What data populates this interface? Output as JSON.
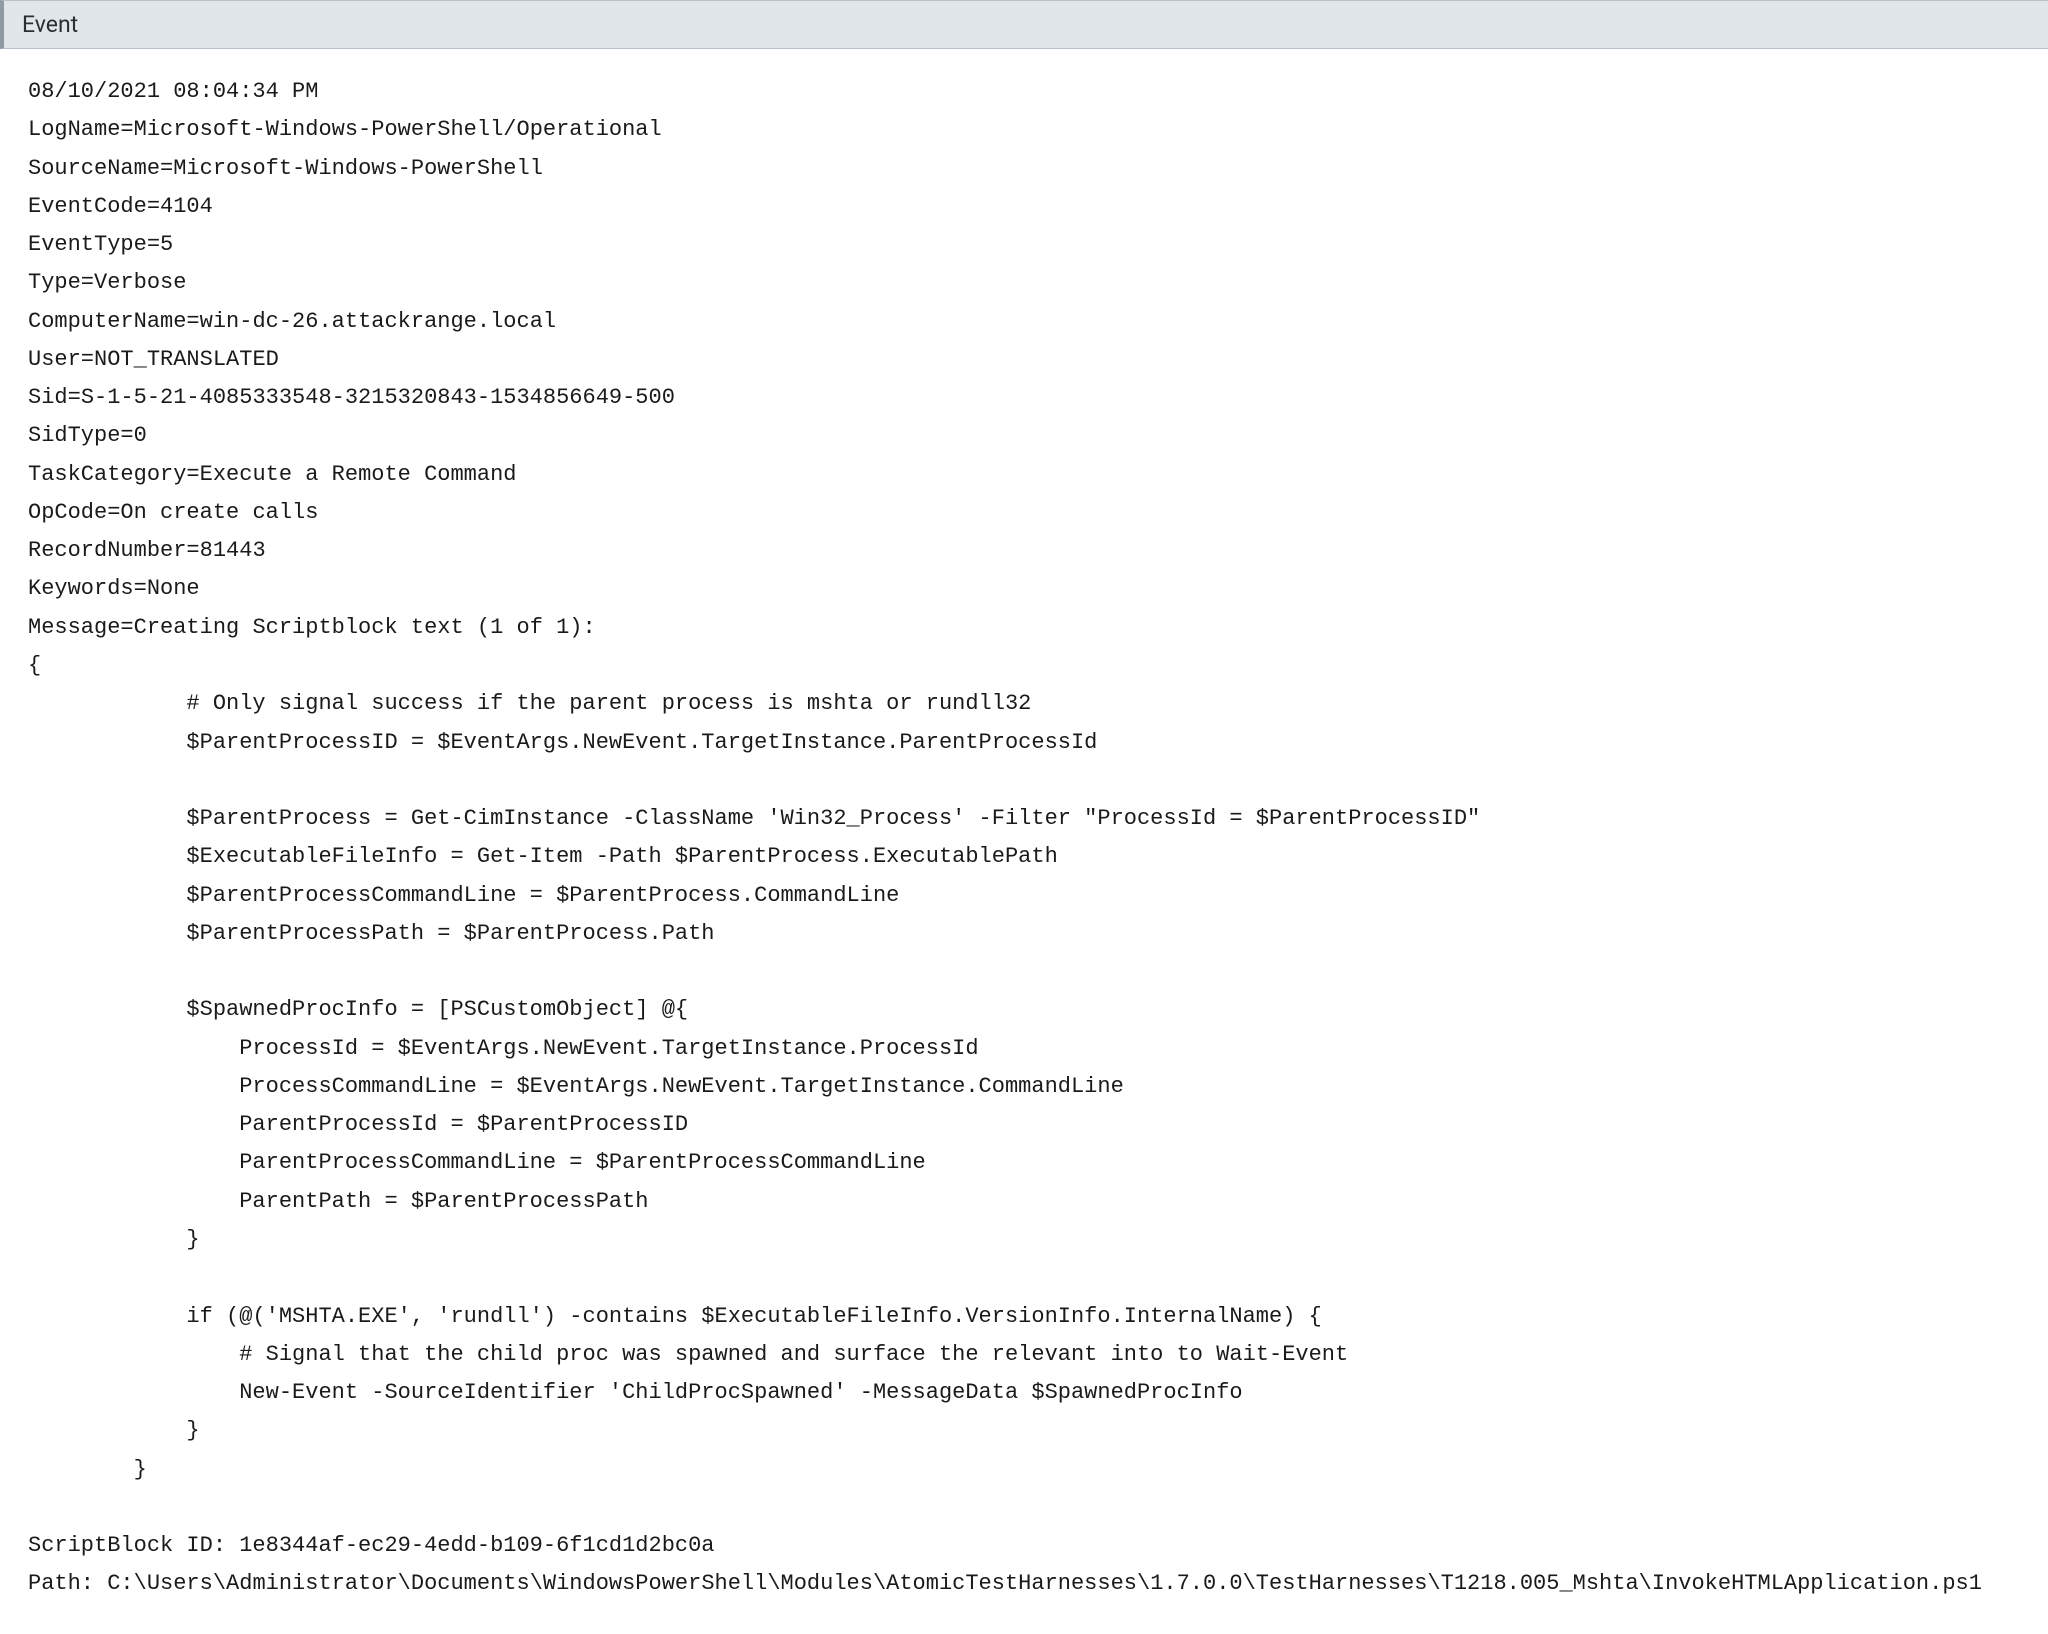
{
  "header": {
    "title": "Event"
  },
  "event": {
    "timestamp": "08/10/2021 08:04:34 PM",
    "LogName": "Microsoft-Windows-PowerShell/Operational",
    "SourceName": "Microsoft-Windows-PowerShell",
    "EventCode": "4104",
    "EventType": "5",
    "Type": "Verbose",
    "ComputerName": "win-dc-26.attackrange.local",
    "User": "NOT_TRANSLATED",
    "Sid": "S-1-5-21-4085333548-3215320843-1534856649-500",
    "SidType": "0",
    "TaskCategory": "Execute a Remote Command",
    "OpCode": "On create calls",
    "RecordNumber": "81443",
    "Keywords": "None",
    "MessageHeader": "Creating Scriptblock text (1 of 1):",
    "ScriptBlock": "{\n            # Only signal success if the parent process is mshta or rundll32\n            $ParentProcessID = $EventArgs.NewEvent.TargetInstance.ParentProcessId\n\n            $ParentProcess = Get-CimInstance -ClassName 'Win32_Process' -Filter \"ProcessId = $ParentProcessID\"\n            $ExecutableFileInfo = Get-Item -Path $ParentProcess.ExecutablePath\n            $ParentProcessCommandLine = $ParentProcess.CommandLine\n            $ParentProcessPath = $ParentProcess.Path\n\n            $SpawnedProcInfo = [PSCustomObject] @{\n                ProcessId = $EventArgs.NewEvent.TargetInstance.ProcessId\n                ProcessCommandLine = $EventArgs.NewEvent.TargetInstance.CommandLine\n                ParentProcessId = $ParentProcessID\n                ParentProcessCommandLine = $ParentProcessCommandLine\n                ParentPath = $ParentProcessPath\n            }\n\n            if (@('MSHTA.EXE', 'rundll') -contains $ExecutableFileInfo.VersionInfo.InternalName) {\n                # Signal that the child proc was spawned and surface the relevant into to Wait-Event\n                New-Event -SourceIdentifier 'ChildProcSpawned' -MessageData $SpawnedProcInfo\n            }\n        }",
    "ScriptBlockID": "1e8344af-ec29-4edd-b109-6f1cd1d2bc0a",
    "Path": "C:\\Users\\Administrator\\Documents\\WindowsPowerShell\\Modules\\AtomicTestHarnesses\\1.7.0.0\\TestHarnesses\\T1218.005_Mshta\\InvokeHTMLApplication.ps1"
  }
}
